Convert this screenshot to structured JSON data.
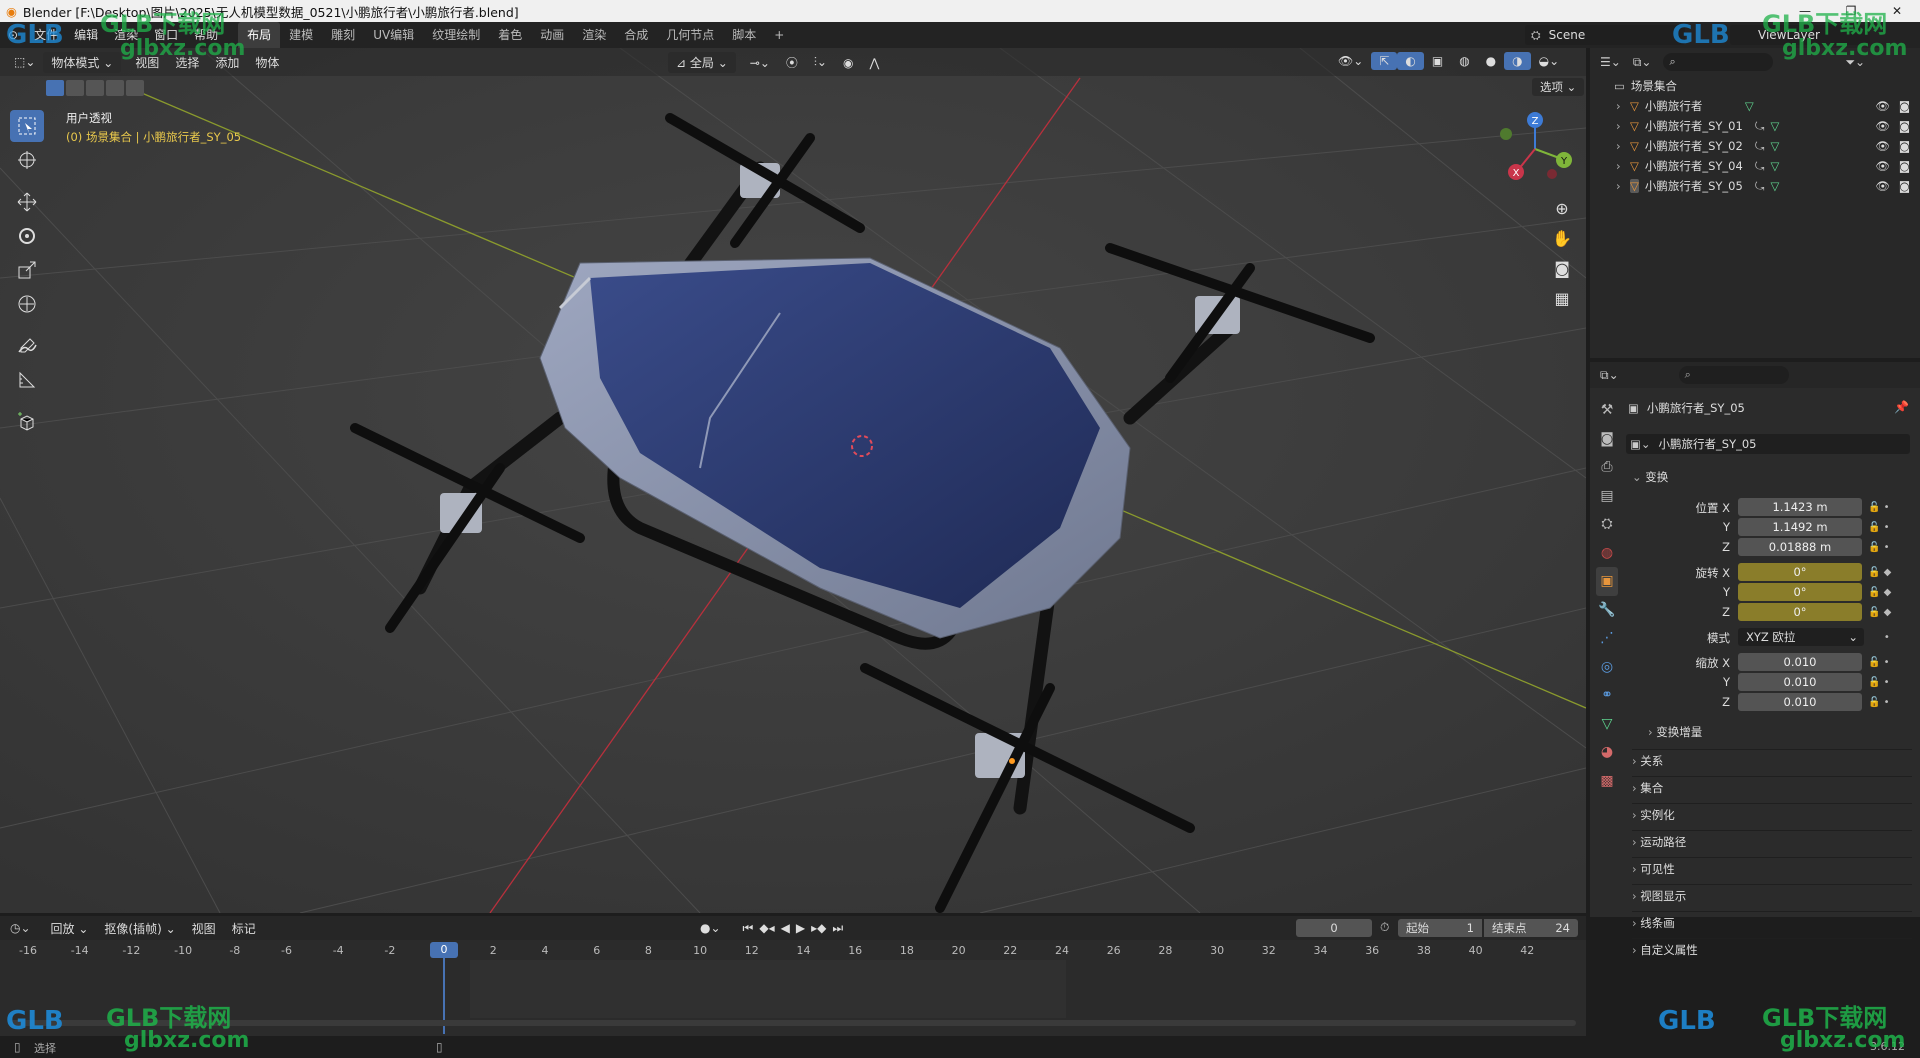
{
  "window": {
    "title": "Blender [F:\\Desktop\\图片\\2025\\无人机模型数据_0521\\小鹏旅行者\\小鹏旅行者.blend]"
  },
  "topmenu": {
    "menus": [
      "文件",
      "编辑",
      "渲染",
      "窗口",
      "帮助"
    ],
    "workspaces": [
      "布局",
      "建模",
      "雕刻",
      "UV编辑",
      "纹理绘制",
      "着色",
      "动画",
      "渲染",
      "合成",
      "几何节点",
      "脚本"
    ],
    "active_workspace": "布局",
    "add_tab": "+",
    "scene": "Scene",
    "view_layer": "ViewLayer"
  },
  "viewport": {
    "mode": "物体模式",
    "menus": [
      "视图",
      "选择",
      "添加",
      "物体"
    ],
    "transform_orientation": "全局",
    "options_label": "选项",
    "view_name": "用户透视",
    "view_info": "(0) 场景集合 | 小鹏旅行者_SY_05"
  },
  "gizmo": {
    "x": "X",
    "y": "Y",
    "z": "Z"
  },
  "outliner": {
    "collection": "场景集合",
    "items": [
      "小鹏旅行者",
      "小鹏旅行者_SY_01",
      "小鹏旅行者_SY_02",
      "小鹏旅行者_SY_04",
      "小鹏旅行者_SY_05"
    ]
  },
  "properties": {
    "object_name": "小鹏旅行者_SY_05",
    "object_field": "小鹏旅行者_SY_05",
    "transform_label": "变换",
    "location_label": "位置 X",
    "location": {
      "x": "1.1423 m",
      "y": "1.1492 m",
      "z": "0.01888 m"
    },
    "rotation_label": "旋转 X",
    "rotation": {
      "x": "0°",
      "y": "0°",
      "z": "0°"
    },
    "mode_label": "模式",
    "mode_value": "XYZ 欧拉",
    "scale_label": "缩放 X",
    "scale": {
      "x": "0.010",
      "y": "0.010",
      "z": "0.010"
    },
    "axis_y": "Y",
    "axis_z": "Z",
    "delta_transform": "变换增量",
    "panels": [
      "关系",
      "集合",
      "实例化",
      "运动路径",
      "可见性",
      "视图显示",
      "线条画",
      "自定义属性"
    ]
  },
  "timeline": {
    "menus": [
      "回放",
      "抠像(插帧)",
      "视图",
      "标记"
    ],
    "current_frame": "0",
    "start_label": "起始",
    "start": "1",
    "end_label": "结束点",
    "end": "24",
    "ruler": [
      "-16",
      "-14",
      "-12",
      "-10",
      "-8",
      "-6",
      "-4",
      "-2",
      "0",
      "2",
      "4",
      "6",
      "8",
      "10",
      "12",
      "14",
      "16",
      "18",
      "20",
      "22",
      "24",
      "26",
      "28",
      "30",
      "32",
      "34",
      "36",
      "38",
      "40",
      "42"
    ],
    "playhead": "0"
  },
  "statusbar": {
    "left": "选择",
    "version": "3.6.12"
  },
  "watermark": {
    "brand": "GLB下载网",
    "domain": "glbxz.com",
    "logo": "GLB"
  },
  "colors": {
    "accent": "#4772b3",
    "rotation_field": "#8a7d2a",
    "x_axis": "#c9354a",
    "y_axis": "#7fb53a",
    "z_axis": "#3d7bd6",
    "watermark_green": "#1fb24a",
    "watermark_blue": "#1d8fe0"
  }
}
